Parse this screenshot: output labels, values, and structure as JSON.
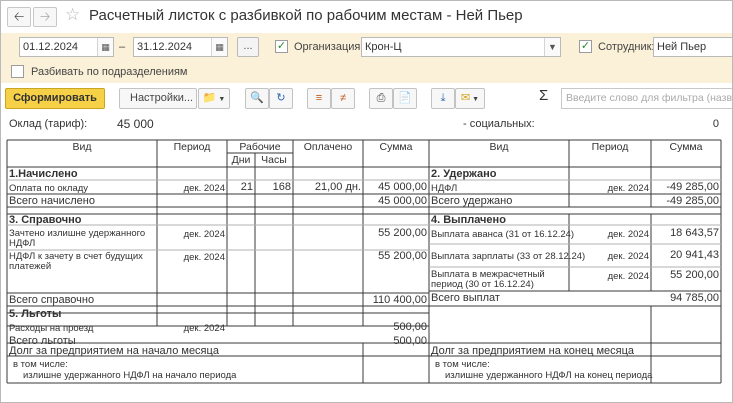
{
  "window": {
    "title": "Расчетный листок с разбивкой по рабочим местам - Ней Пьер"
  },
  "filters": {
    "date_from": "01.12.2024",
    "date_to": "31.12.2024",
    "dash": "–",
    "period_button": "...",
    "org_label": "Организация:",
    "org_value": "Крон-Ц",
    "employee_label": "Сотрудник:",
    "employee_value": "Ней Пьер",
    "split_label": "Разбивать по подразделениям"
  },
  "toolbar": {
    "generate": "Сформировать",
    "settings": "Настройки...",
    "search_placeholder": "Введите слово для фильтра (название..."
  },
  "report": {
    "salary_label": "Оклад (тариф):",
    "salary_value": "45 000",
    "social_label": "- социальных:",
    "social_value": "0",
    "left_headers": {
      "kind": "Вид",
      "period": "Период",
      "working": "Рабочие",
      "days": "Дни",
      "hours": "Часы",
      "paid": "Оплачено",
      "sum": "Сумма"
    },
    "right_headers": {
      "kind": "Вид",
      "period": "Период",
      "sum": "Сумма"
    },
    "sec1": "1.Начислено",
    "sec2": "2. Удержано",
    "sec3": "3. Справочно",
    "sec4": "4. Выплачено",
    "sec5": "5. Льготы",
    "accrued_row": {
      "kind": "Оплата по окладу",
      "period": "дек. 2024",
      "days": "21",
      "hours": "168",
      "paid": "21,00 дн.",
      "sum": "45 000,00"
    },
    "accrued_total": {
      "label": "Всего начислено",
      "sum": "45 000,00"
    },
    "withheld_row": {
      "kind": "НДФЛ",
      "period": "дек. 2024",
      "sum": "-49 285,00"
    },
    "withheld_total": {
      "label": "Всего удержано",
      "sum": "-49 285,00"
    },
    "ref_rows": [
      {
        "kind": "Зачтено излишне удержанного НДФЛ",
        "period": "дек. 2024",
        "sum": "55 200,00"
      },
      {
        "kind": "НДФЛ к зачету в счет будущих платежей",
        "period": "дек. 2024",
        "sum": "55 200,00"
      }
    ],
    "ref_total": {
      "label": "Всего справочно",
      "sum": "110 400,00"
    },
    "paid_rows": [
      {
        "kind": "Выплата аванса (31 от 16.12.24)",
        "period": "дек. 2024",
        "sum": "18 643,57"
      },
      {
        "kind": "Выплата зарплаты (33 от 28.12.24)",
        "period": "дек. 2024",
        "sum": "20 941,43"
      },
      {
        "kind": "Выплата в межрасчетный период (30 от 16.12.24)",
        "period": "дек. 2024",
        "sum": "55 200,00"
      }
    ],
    "paid_total": {
      "label": "Всего выплат",
      "sum": "94 785,00"
    },
    "benefit_row": {
      "kind": "Расходы на проезд",
      "period": "дек. 2024",
      "sum": "500,00"
    },
    "benefit_total": {
      "label": "Всего льготы",
      "sum": "500,00"
    },
    "debt_start": "Долг за предприятием на начало месяца",
    "debt_end": "Долг за предприятием на конец месяца",
    "including": "в том числе:",
    "excess_start": "излишне удержанного НДФЛ на начало периода",
    "excess_end": "излишне удержанного НДФЛ на конец периода"
  }
}
